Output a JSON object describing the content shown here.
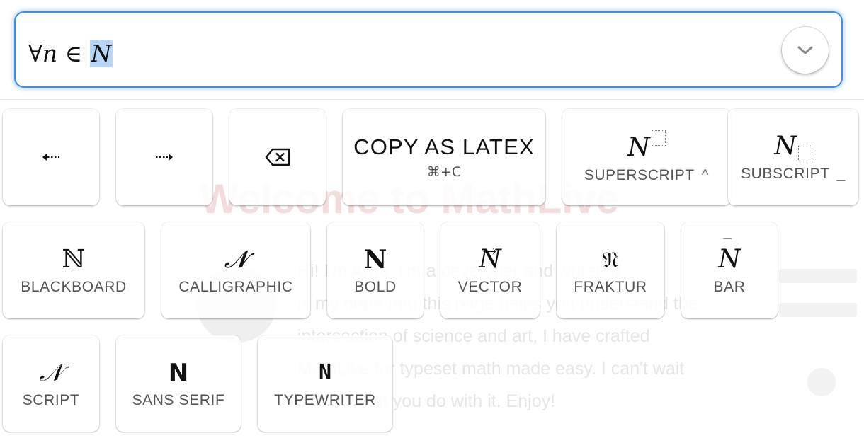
{
  "background": {
    "title": "Welcome to MathLive",
    "paragraph_lines": [
      "Hi! I'm Arno. I'm a developer and writer. It",
      "is my hope that this page helps you understand the",
      "intersection of science and art, I have crafted",
      "MathLive for typeset math made easy. I can't wait",
      "to see what you do with it. Enjoy!"
    ]
  },
  "mathfield": {
    "tokens": [
      "∀",
      "n",
      " ∈ ",
      "N"
    ],
    "toggle_icon": "chevron-down-icon"
  },
  "keyboard": {
    "row1": {
      "move_left": {
        "icon": "arrow-left-icon",
        "glyph": "⇠"
      },
      "move_right": {
        "icon": "arrow-right-icon",
        "glyph": "⇢"
      },
      "backspace": {
        "icon": "backspace-icon"
      },
      "copy_latex": {
        "label": "COPY AS LATEX",
        "shortcut": "⌘+C"
      },
      "superscript": {
        "glyph": "N",
        "label": "SUPERSCRIPT",
        "shortcut": "^"
      },
      "subscript": {
        "glyph": "N",
        "label": "SUBSCRIPT",
        "shortcut": "_"
      }
    },
    "row2": [
      {
        "name": "blackboard",
        "glyph": "ℕ",
        "label": "BLACKBOARD"
      },
      {
        "name": "calligraphic",
        "glyph": "𝓝",
        "label": "CALLIGRAPHIC"
      },
      {
        "name": "bold",
        "glyph": "N",
        "label": "BOLD"
      },
      {
        "name": "vector",
        "glyph": "N",
        "accent": "→",
        "label": "VECTOR"
      },
      {
        "name": "fraktur",
        "glyph": "𝔑",
        "label": "FRAKTUR"
      },
      {
        "name": "bar",
        "glyph": "N",
        "accent": "‾",
        "label": "BAR"
      }
    ],
    "row3": [
      {
        "name": "script",
        "glyph": "𝒩",
        "label": "SCRIPT"
      },
      {
        "name": "sans-serif",
        "glyph": "N",
        "label": "SANS SERIF"
      },
      {
        "name": "typewriter",
        "glyph": "N",
        "label": "TYPEWRITER"
      }
    ]
  },
  "colors": {
    "focus_ring": "#3d8ee8",
    "selection": "#b9d6f6",
    "bg_title": "#f3dcdc"
  }
}
